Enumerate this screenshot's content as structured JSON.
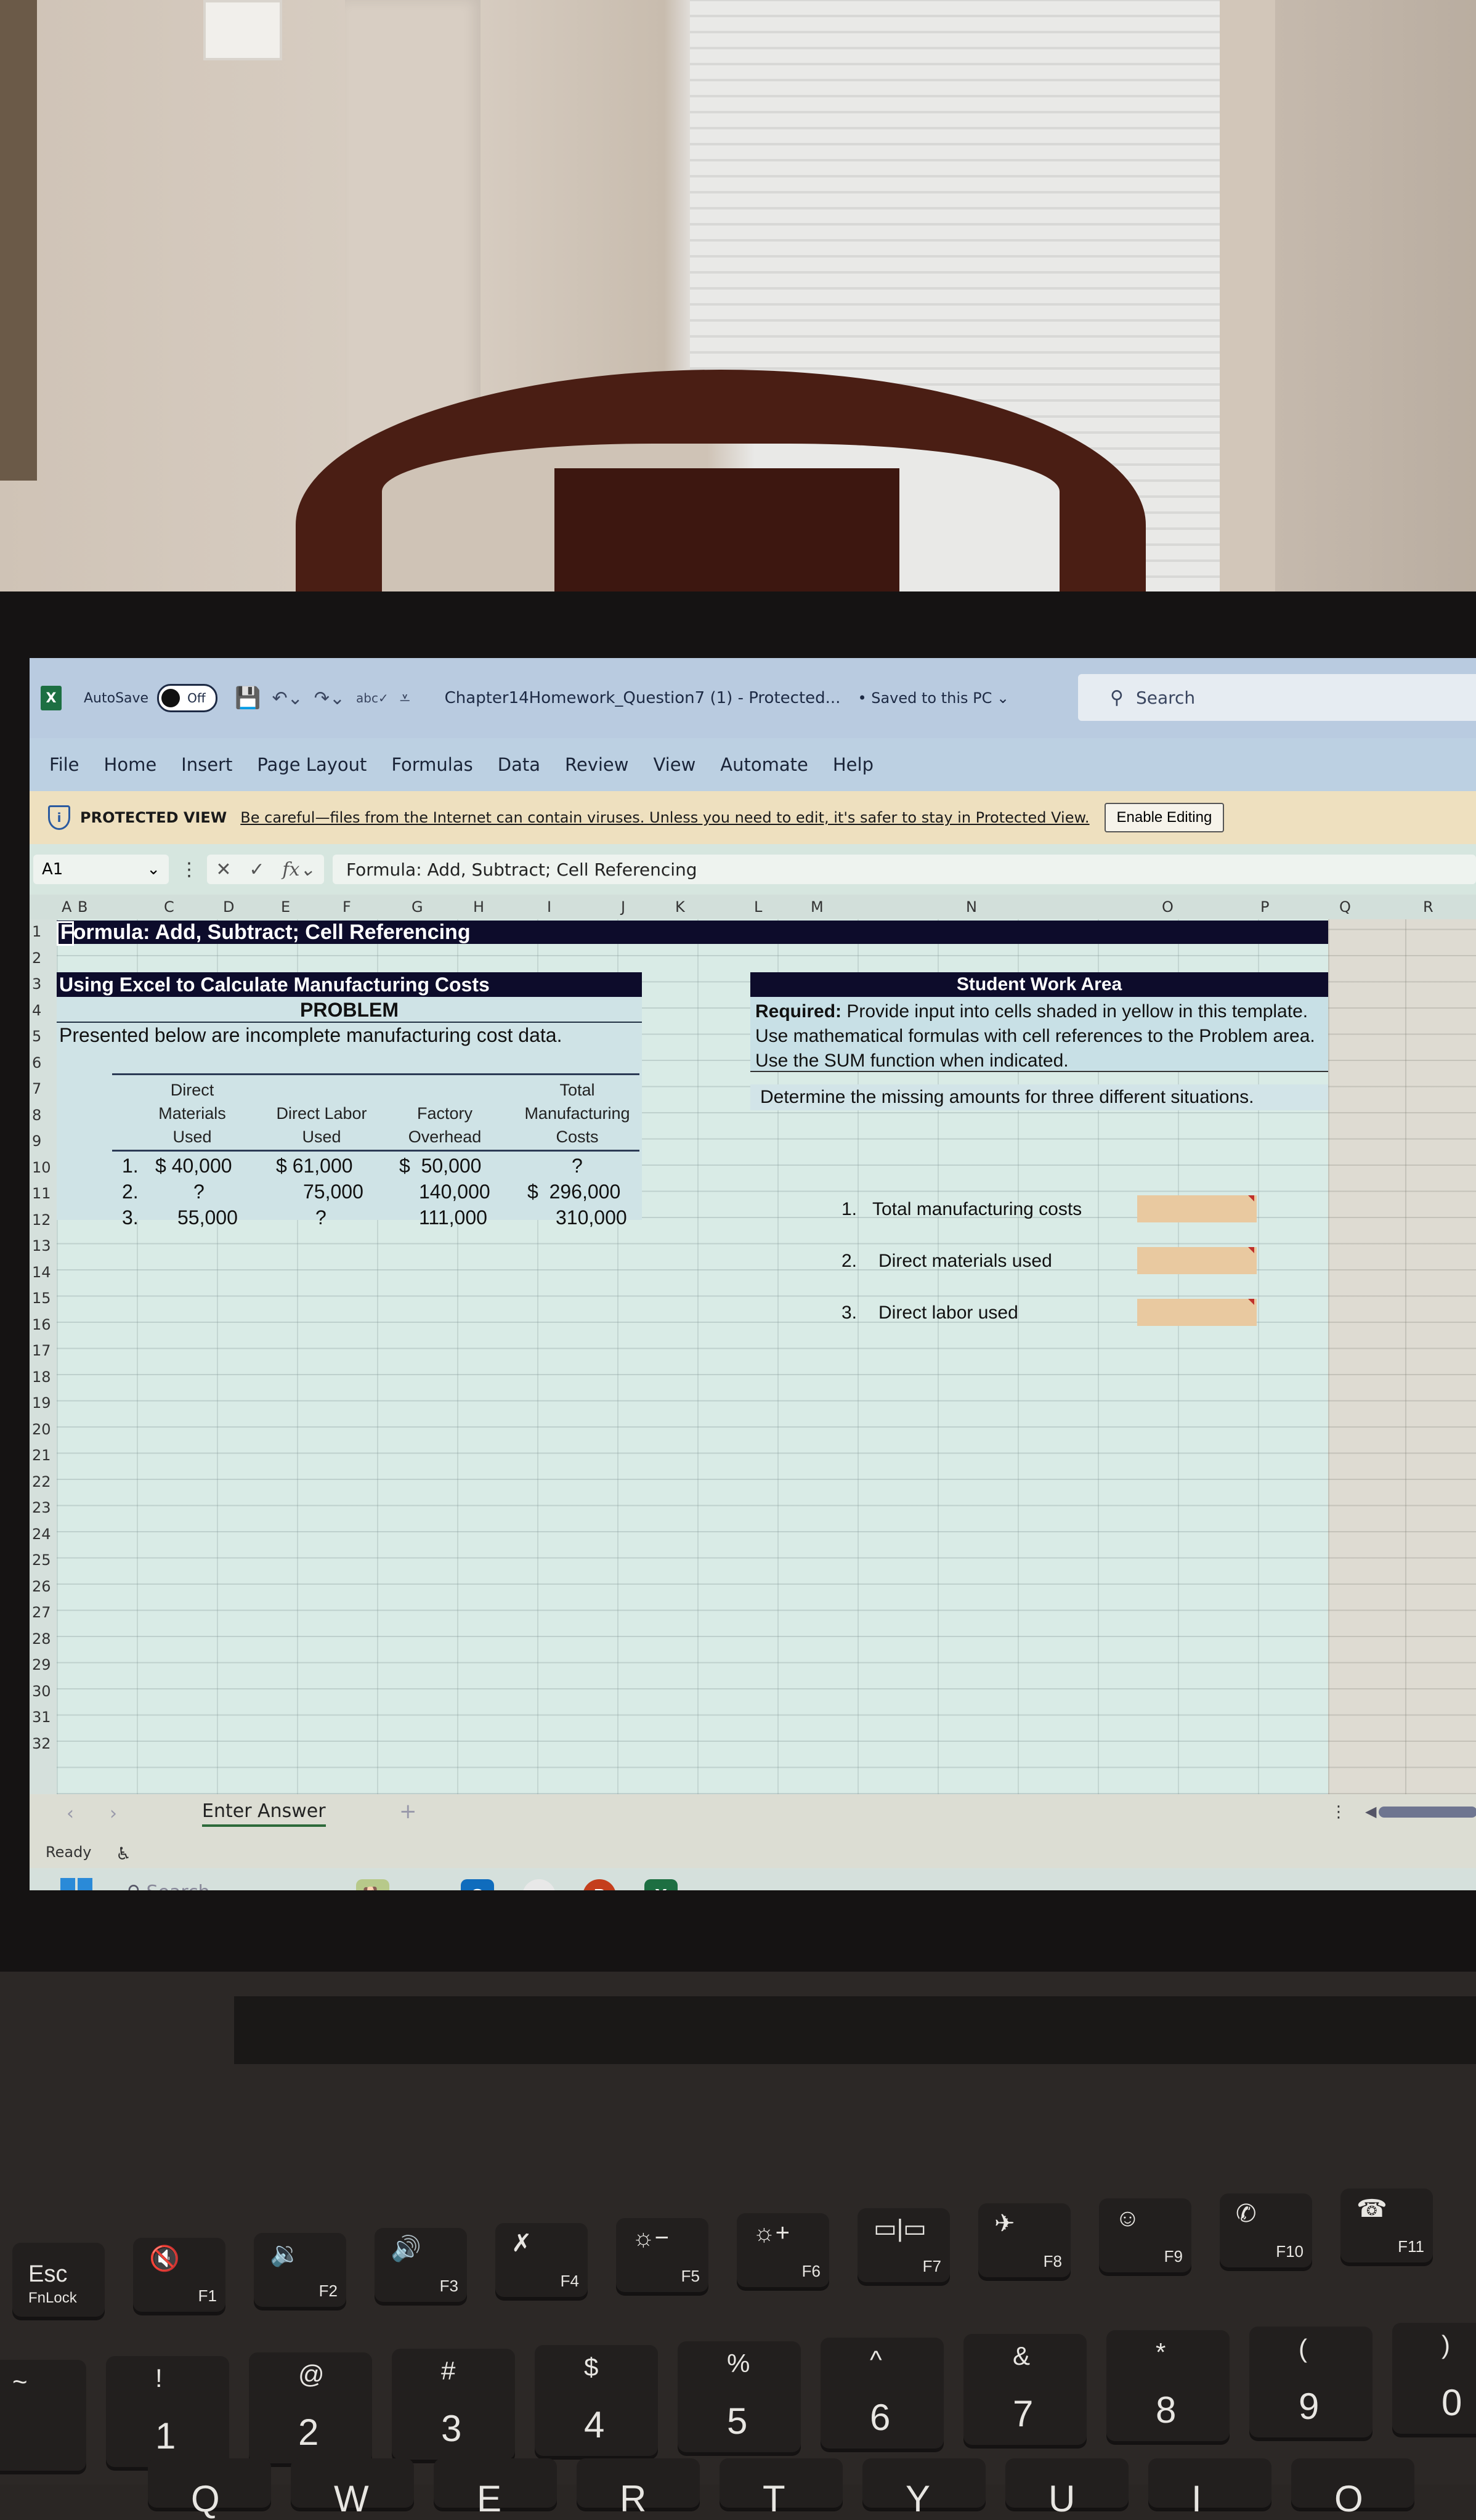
{
  "titlebar": {
    "app_icon": "excel-icon",
    "autosave_label": "AutoSave",
    "autosave_state": "Off",
    "doc_title": "Chapter14Homework_Question7 (1)  -  Protected...",
    "saved_status": "• Saved to this PC ⌄",
    "search_placeholder": "Search"
  },
  "menu": [
    "File",
    "Home",
    "Insert",
    "Page Layout",
    "Formulas",
    "Data",
    "Review",
    "View",
    "Automate",
    "Help"
  ],
  "protected_view": {
    "title": "PROTECTED VIEW",
    "message": "Be careful—files from the Internet can contain viruses. Unless you need to edit, it's safer to stay in Protected View.",
    "button": "Enable Editing"
  },
  "formula_bar": {
    "name_box": "A1",
    "formula": "Formula: Add, Subtract; Cell Referencing"
  },
  "columns": [
    "A",
    "B",
    "C",
    "D",
    "E",
    "F",
    "G",
    "H",
    "I",
    "J",
    "K",
    "L",
    "M",
    "N",
    "O",
    "P",
    "Q",
    "R"
  ],
  "rows": [
    "1",
    "2",
    "3",
    "4",
    "5",
    "6",
    "7",
    "8",
    "9",
    "10",
    "11",
    "12",
    "13",
    "14",
    "15",
    "16",
    "17",
    "18",
    "19",
    "20",
    "21",
    "22",
    "23",
    "24",
    "25",
    "26",
    "27",
    "28",
    "29",
    "30",
    "31",
    "32"
  ],
  "sheet": {
    "a1_title": "Formula: Add, Subtract; Cell Referencing",
    "section_title": "Using Excel to Calculate Manufacturing Costs",
    "problem_label": "PROBLEM",
    "intro": "Presented below are incomplete manufacturing cost data.",
    "table": {
      "headers": [
        [
          "Direct",
          "Materials",
          "Used"
        ],
        [
          "",
          "Direct Labor",
          "Used"
        ],
        [
          "",
          "Factory",
          "Overhead"
        ],
        [
          "Total",
          "Manufacturing",
          "Costs"
        ]
      ],
      "rows": [
        {
          "num": "1.",
          "dm": "$ 40,000",
          "dl": "$ 61,000",
          "fo": "$  50,000",
          "tmc": "?"
        },
        {
          "num": "2.",
          "dm": "?",
          "dl": "75,000",
          "fo": "140,000",
          "tmc": "$  296,000"
        },
        {
          "num": "3.",
          "dm": "55,000",
          "dl": "?",
          "fo": "111,000",
          "tmc": "310,000"
        }
      ]
    },
    "work_area": {
      "title": "Student Work Area",
      "required_bold": "Required:",
      "required_text": " Provide input into cells shaded in yellow in this template. Use mathematical formulas with cell references to the Problem area. Use the SUM function when indicated.",
      "determine": "Determine the missing amounts for three different situations.",
      "questions": [
        {
          "num": "1.",
          "label": "Total manufacturing costs",
          "value": ""
        },
        {
          "num": "2.",
          "label": "Direct materials used",
          "value": ""
        },
        {
          "num": "3.",
          "label": "Direct labor used",
          "value": ""
        }
      ]
    },
    "answer_fill_color": "#e9c9a0",
    "header_bar_color": "#0d0c2b"
  },
  "sheet_tabs": {
    "active": "Enter Answer",
    "add": "+"
  },
  "status_bar": {
    "ready": "Ready"
  },
  "taskbar": {
    "search_placeholder": "Search",
    "apps": [
      "widgets",
      "outlook-new",
      "chrome",
      "powerpoint",
      "excel"
    ]
  },
  "keyboard": {
    "fn_row": [
      {
        "main": "Esc",
        "sub": "FnLock"
      },
      {
        "icon": "🔇",
        "fn": "F1"
      },
      {
        "icon": "🔉",
        "fn": "F2"
      },
      {
        "icon": "🔊",
        "fn": "F3"
      },
      {
        "icon": "✗",
        "fn": "F4"
      },
      {
        "icon": "☼−",
        "fn": "F5"
      },
      {
        "icon": "☼+",
        "fn": "F6"
      },
      {
        "icon": "▭|▭",
        "fn": "F7"
      },
      {
        "icon": "✈",
        "fn": "F8"
      },
      {
        "icon": "☺",
        "fn": "F9"
      },
      {
        "icon": "✆",
        "fn": "F10"
      },
      {
        "icon": "☎",
        "fn": "F11"
      }
    ],
    "num_row": [
      {
        "top": "~",
        "bot": ""
      },
      {
        "top": "!",
        "bot": "1"
      },
      {
        "top": "@",
        "bot": "2"
      },
      {
        "top": "#",
        "bot": "3"
      },
      {
        "top": "$",
        "bot": "4"
      },
      {
        "top": "%",
        "bot": "5"
      },
      {
        "top": "^",
        "bot": "6"
      },
      {
        "top": "&",
        "bot": "7"
      },
      {
        "top": "*",
        "bot": "8"
      },
      {
        "top": "(",
        "bot": "9"
      },
      {
        "top": ")",
        "bot": "0"
      }
    ],
    "letter_row": [
      "Q",
      "W",
      "E",
      "R",
      "T",
      "Y",
      "U",
      "I",
      "O"
    ]
  }
}
